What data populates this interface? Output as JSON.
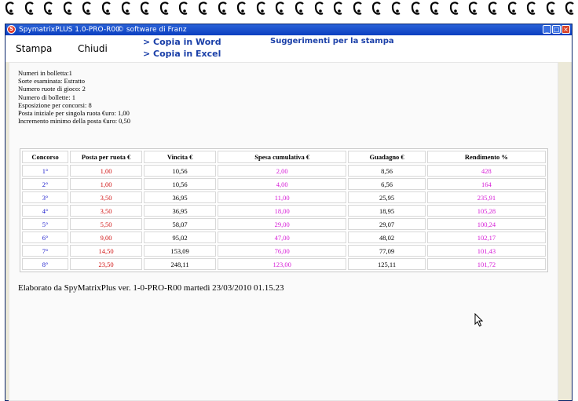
{
  "window": {
    "title": "SpymatrixPLUS 1.0-PRO-R00",
    "subtitle": "© software di Franz"
  },
  "toolbar": {
    "stampa": "Stampa",
    "chiudi": "Chiudi",
    "copia_word": "> Copia in Word",
    "copia_excel": "> Copia in Excel",
    "suggerimenti": "Suggerimenti per la stampa"
  },
  "info": [
    "Numeri in bolletta:1",
    "Sorte esaminata: Estratto",
    "Numero ruote di gioco: 2",
    "Numero di bollette: 1",
    "Esposizione per concorsi: 8",
    "Posta iniziale per singola ruota €uro: 1,00",
    "Incremento minimo della posta €uro: 0,50"
  ],
  "table": {
    "headers": [
      "Concorso",
      "Posta per ruota €",
      "Vincita €",
      "Spesa cumulativa €",
      "Guadagno €",
      "Rendimento %"
    ],
    "rows": [
      [
        "1°",
        "1,00",
        "10,56",
        "2,00",
        "8,56",
        "428"
      ],
      [
        "2°",
        "1,00",
        "10,56",
        "4,00",
        "6,56",
        "164"
      ],
      [
        "3°",
        "3,50",
        "36,95",
        "11,00",
        "25,95",
        "235,91"
      ],
      [
        "4°",
        "3,50",
        "36,95",
        "18,00",
        "18,95",
        "105,28"
      ],
      [
        "5°",
        "5,50",
        "58,07",
        "29,00",
        "29,07",
        "100,24"
      ],
      [
        "6°",
        "9,00",
        "95,02",
        "47,00",
        "48,02",
        "102,17"
      ],
      [
        "7°",
        "14,50",
        "153,09",
        "76,00",
        "77,09",
        "101,43"
      ],
      [
        "8°",
        "23,50",
        "248,11",
        "123,00",
        "125,11",
        "101,72"
      ]
    ],
    "column_colors": [
      "#1a1acc",
      "#d01010",
      "#000000",
      "#d61ad6",
      "#000000",
      "#d61ad6"
    ]
  },
  "footer": "Elaborato da SpyMatrixPlus ver. 1-0-PRO-R00 martedì 23/03/2010 01.15.23"
}
